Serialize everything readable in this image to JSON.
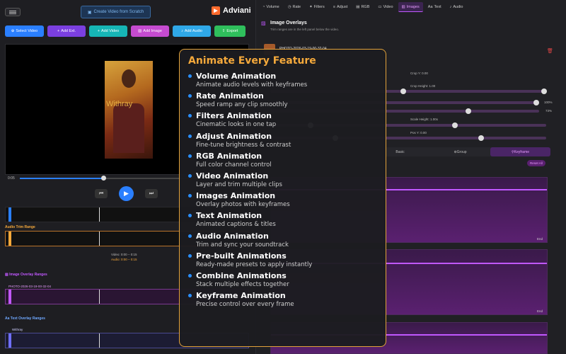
{
  "header": {
    "scratch_button": "Create Video from Scratch",
    "app_name": "Adviani"
  },
  "toolbar": [
    {
      "label": "Select Video",
      "color": "#2a7fff",
      "icon": "upload-icon"
    },
    {
      "label": "Add Ext.",
      "color": "#7b3fe0",
      "icon": "plus-icon"
    },
    {
      "label": "Add Video",
      "color": "#16b6b6",
      "icon": "plus-icon"
    },
    {
      "label": "Add Image",
      "color": "#c54bd0",
      "icon": "image-icon"
    },
    {
      "label": "Add Audio",
      "color": "#2fa8e8",
      "icon": "music-icon"
    },
    {
      "label": "Export",
      "color": "#2fbf5c",
      "icon": "export-icon"
    }
  ],
  "preview": {
    "watermark": "Withray",
    "current_time": "0:05",
    "progress": 0.37
  },
  "timeline": {
    "audio_trim_label": "Audio Trim Range",
    "video_range": "Video: 0:00 – 0:15",
    "audio_range": "Audio: 0:00 – 0:15",
    "image_overlay_label": "Image Overlay Ranges",
    "image_item": "PHOTO-2026-03-19-00-32-04",
    "text_overlay_label": "Text Overlay Ranges",
    "text_item": "Withray"
  },
  "tabs": [
    {
      "label": "Volume",
      "icon": "volume-icon",
      "active": false
    },
    {
      "label": "Rate",
      "icon": "clock-icon",
      "active": false
    },
    {
      "label": "Filters",
      "icon": "filter-icon",
      "active": false
    },
    {
      "label": "Adjust",
      "icon": "sliders-icon",
      "active": false
    },
    {
      "label": "RGB",
      "icon": "rgb-icon",
      "active": false
    },
    {
      "label": "Video",
      "icon": "video-icon",
      "active": false
    },
    {
      "label": "Images",
      "icon": "image-icon",
      "active": true
    },
    {
      "label": "Text",
      "icon": "text-icon",
      "active": false
    },
    {
      "label": "Audio",
      "icon": "music-icon",
      "active": false
    }
  ],
  "panel": {
    "title": "Image Overlays",
    "subtitle": "Trim ranges are in the left panel below the video.",
    "item_name": "PHOTO-2026-03-19-00-32-04",
    "crop_y": "Crop Y: 0.00",
    "crop_height": "Crop Height: 1.00",
    "opacity_value": "100%",
    "second_value": "73%",
    "scale_height": "Scale Height: 1.00x",
    "pos_y": "Pos Y: 0.00",
    "seg_basic": "Basic",
    "seg_group": "Group",
    "seg_keyframe": "Keyframe",
    "reset_all": "Reset All",
    "end_label": "End"
  },
  "overlay": {
    "title": "Animate Every Feature",
    "features": [
      {
        "title": "Volume Animation",
        "desc": "Animate audio levels with keyframes"
      },
      {
        "title": "Rate Animation",
        "desc": "Speed ramp any clip smoothly"
      },
      {
        "title": "Filters Animation",
        "desc": "Cinematic looks in one tap"
      },
      {
        "title": "Adjust Animation",
        "desc": "Fine-tune brightness & contrast"
      },
      {
        "title": "RGB Animation",
        "desc": "Full color channel control"
      },
      {
        "title": "Video Animation",
        "desc": "Layer and trim multiple clips"
      },
      {
        "title": "Images Animation",
        "desc": "Overlay photos with keyframes"
      },
      {
        "title": "Text Animation",
        "desc": "Animated captions & titles"
      },
      {
        "title": "Audio Animation",
        "desc": "Trim and sync your soundtrack"
      },
      {
        "title": "Pre-built Animations",
        "desc": "Ready-made presets to apply instantly"
      },
      {
        "title": "Combine Animations",
        "desc": "Stack multiple effects together"
      },
      {
        "title": "Keyframe Animation",
        "desc": "Precise control over every frame"
      }
    ]
  }
}
